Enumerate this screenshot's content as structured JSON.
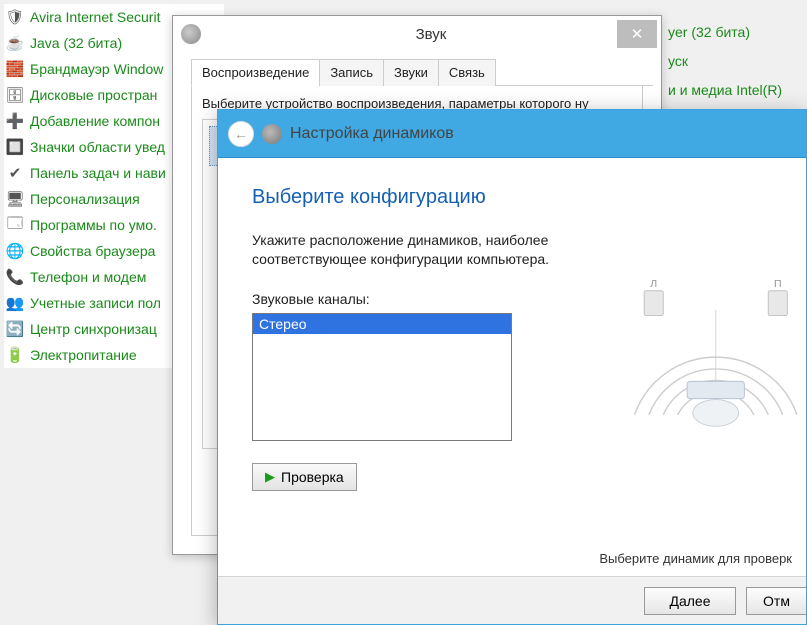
{
  "control_panel": {
    "items": [
      {
        "label": "Avira Internet Securit",
        "icon": "🛡"
      },
      {
        "label": "Java (32 бита)",
        "icon": "☕"
      },
      {
        "label": "Брандмауэр Window",
        "icon": "🧱"
      },
      {
        "label": "Дисковые простран",
        "icon": "🗄"
      },
      {
        "label": "Добавление компон",
        "icon": "➕"
      },
      {
        "label": "Значки области увед",
        "icon": "🔲"
      },
      {
        "label": "Панель задач и нави",
        "icon": "✔"
      },
      {
        "label": "Персонализация",
        "icon": "🖥"
      },
      {
        "label": "Программы по умо.",
        "icon": "🗔"
      },
      {
        "label": "Свойства браузера",
        "icon": "🌐"
      },
      {
        "label": "Телефон и модем",
        "icon": "📞"
      },
      {
        "label": "Учетные записи пол",
        "icon": "👥"
      },
      {
        "label": "Центр синхронизац",
        "icon": "🔄"
      },
      {
        "label": "Электропитание",
        "icon": "🔋"
      }
    ],
    "extra_right": [
      "yer (32 бита)",
      "уск",
      "и и медиа Intel(R)"
    ]
  },
  "sound_dialog": {
    "title": "Звук",
    "tabs": [
      "Воспроизведение",
      "Запись",
      "Звуки",
      "Связь"
    ],
    "instruction": "Выберите устройство воспроизведения, параметры которого ну"
  },
  "wizard": {
    "title": "Настройка динамиков",
    "heading": "Выберите конфигурацию",
    "text1": "Укажите расположение динамиков, наиболее",
    "text2": "соответствующее конфигурации компьютера.",
    "channels_label": "Звуковые каналы:",
    "channels": [
      "Стерео"
    ],
    "test_label": "Проверка",
    "hint": "Выберите динамик для проверк",
    "next_label": "Далее",
    "cancel_label": "Отм"
  },
  "illustration": {
    "left_label": "Л",
    "right_label": "П"
  }
}
